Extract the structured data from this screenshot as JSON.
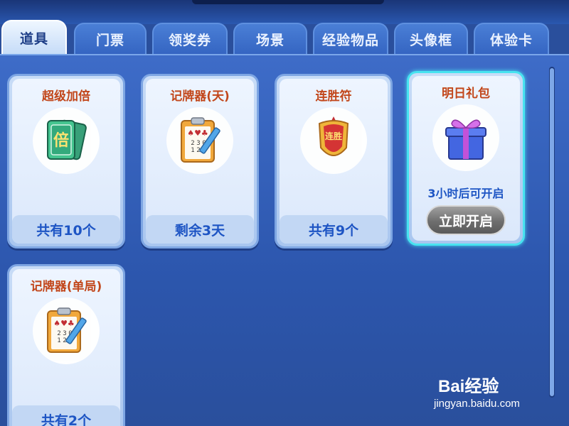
{
  "tabs": [
    {
      "label": "道具",
      "active": true
    },
    {
      "label": "门票",
      "active": false
    },
    {
      "label": "领奖券",
      "active": false
    },
    {
      "label": "场景",
      "active": false
    },
    {
      "label": "经验物品",
      "active": false
    },
    {
      "label": "头像框",
      "active": false
    },
    {
      "label": "体验卡",
      "active": false
    }
  ],
  "items": [
    {
      "title": "超级加倍",
      "icon": "double-card-icon",
      "footer": "共有10个"
    },
    {
      "title": "记牌器(天)",
      "icon": "card-counter-clipboard-icon",
      "footer": "剩余3天"
    },
    {
      "title": "连胜符",
      "icon": "win-streak-badge-icon",
      "footer": "共有9个",
      "badge_text": "连胜"
    },
    {
      "title": "明日礼包",
      "icon": "gift-box-icon",
      "timer": "3小时后可开启",
      "button": "立即开启"
    },
    {
      "title": "记牌器(单局)",
      "icon": "card-counter-clipboard-icon",
      "footer": "共有2个"
    }
  ],
  "icon_text": {
    "double": "倍",
    "card_numbers": [
      "2",
      "3",
      "0",
      "1",
      "2"
    ]
  },
  "watermark": {
    "brand": "Bai经验",
    "url": "jingyan.baidu.com"
  },
  "colors": {
    "tab_active_text": "#1f3f88",
    "title_text": "#c2471b",
    "footer_text": "#1e55c4",
    "highlight_border": "#48e3f0"
  }
}
